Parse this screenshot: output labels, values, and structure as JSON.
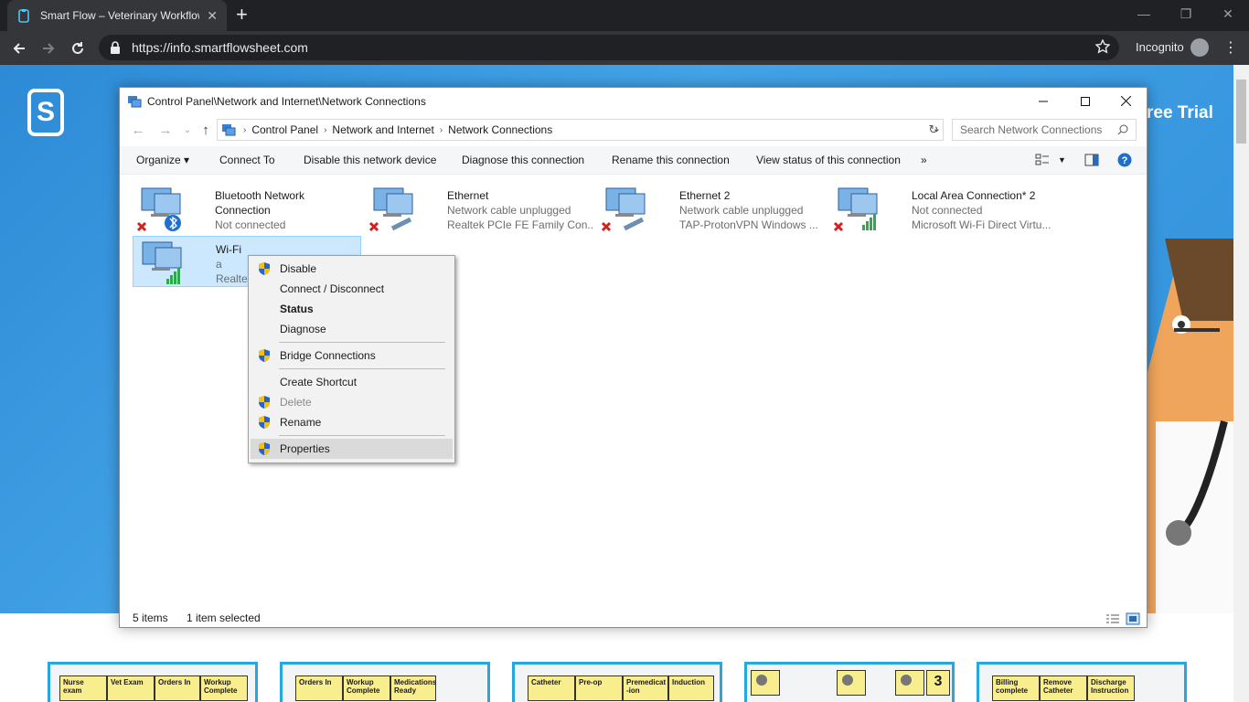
{
  "browser": {
    "tab_title": "Smart Flow – Veterinary Workflow",
    "url": "https://info.smartflowsheet.com",
    "profile_label": "Incognito"
  },
  "page": {
    "logo_text": "S",
    "cta": "ree Trial",
    "cards": [
      [
        "Nurse exam",
        "Vet Exam",
        "Orders In",
        "Workup Complete"
      ],
      [
        "Orders In",
        "Workup Complete",
        "Medications Ready"
      ],
      [
        "Catheter",
        "Pre-op",
        "Premedicat -ion",
        "Induction"
      ],
      [
        "3"
      ],
      [
        "Billing complete",
        "Remove Catheter",
        "Discharge Instruction"
      ]
    ]
  },
  "window": {
    "title": "Control Panel\\Network and Internet\\Network Connections",
    "breadcrumb": [
      "Control Panel",
      "Network and Internet",
      "Network Connections"
    ],
    "search_placeholder": "Search Network Connections",
    "commands": [
      "Organize",
      "Connect To",
      "Disable this network device",
      "Diagnose this connection",
      "Rename this connection",
      "View status of this connection",
      "»"
    ],
    "items": [
      {
        "name": "Bluetooth Network Connection",
        "status": "Not connected",
        "device": ""
      },
      {
        "name": "Ethernet",
        "status": "Network cable unplugged",
        "device": "Realtek PCIe FE Family Con..."
      },
      {
        "name": "Ethernet 2",
        "status": "Network cable unplugged",
        "device": "TAP-ProtonVPN Windows ..."
      },
      {
        "name": "Local Area Connection* 2",
        "status": "Not connected",
        "device": "Microsoft Wi-Fi Direct Virtu..."
      },
      {
        "name": "Wi-Fi",
        "status": "a",
        "device": "Realtek"
      }
    ],
    "status": {
      "count": "5 items",
      "selected": "1 item selected"
    }
  },
  "context_menu": [
    {
      "label": "Disable",
      "shield": true
    },
    {
      "label": "Connect / Disconnect",
      "shield": false
    },
    {
      "label": "Status",
      "shield": false
    },
    {
      "label": "Diagnose",
      "shield": false
    },
    {
      "label": "Bridge Connections",
      "shield": true
    },
    {
      "label": "Create Shortcut",
      "shield": false
    },
    {
      "label": "Delete",
      "shield": true
    },
    {
      "label": "Rename",
      "shield": true
    },
    {
      "label": "Properties",
      "shield": true
    }
  ]
}
